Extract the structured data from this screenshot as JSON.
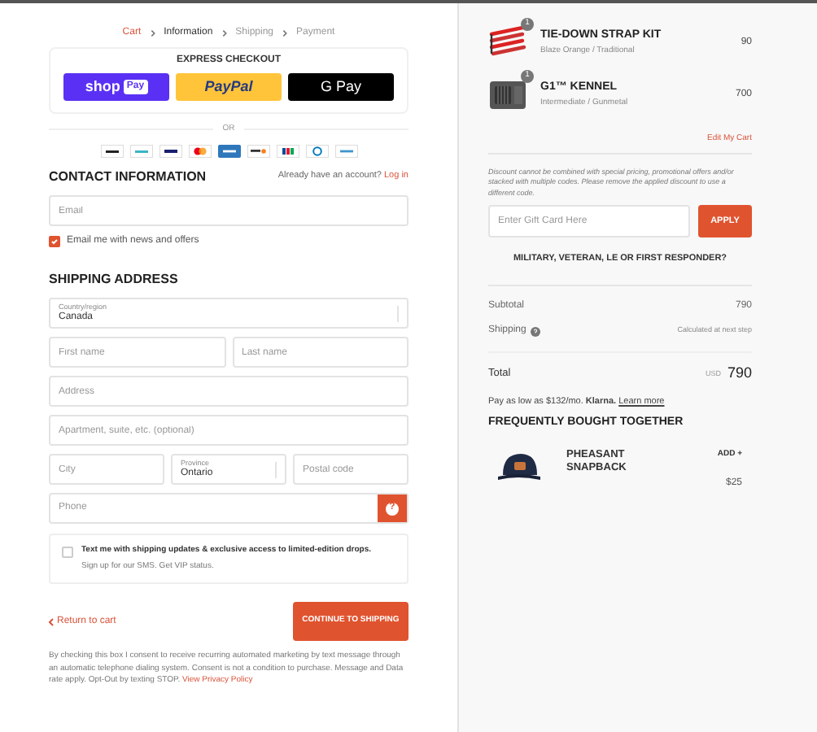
{
  "breadcrumb": [
    {
      "label": "Cart",
      "selected": false,
      "kind": "link"
    },
    {
      "label": "Information",
      "selected": true,
      "kind": "step"
    },
    {
      "label": "Shipping",
      "selected": false,
      "kind": "step"
    },
    {
      "label": "Payment",
      "selected": false,
      "kind": "step"
    }
  ],
  "express_checkout": {
    "title": "EXPRESS CHECKOUT",
    "buttons": [
      {
        "kind": "shop",
        "label": "shop",
        "badge": "Pay"
      },
      {
        "kind": "paypal",
        "label": "PayPal"
      },
      {
        "kind": "gpay",
        "label": "G Pay"
      }
    ]
  },
  "divider_label": "OR",
  "payment_methods": [
    {
      "kind": "klarna"
    },
    {
      "kind": "afterpay"
    },
    {
      "kind": "visa"
    },
    {
      "kind": "mastercard"
    },
    {
      "kind": "amex"
    },
    {
      "kind": "discover"
    },
    {
      "kind": "jcb"
    },
    {
      "kind": "diners"
    },
    {
      "kind": "venmo"
    }
  ],
  "contact": {
    "title": "CONTACT INFORMATION",
    "account_prompt": "Already have an account?",
    "login_link": "Log in",
    "email_placeholder": "Email",
    "newsletter": {
      "label": "Email me with news and offers",
      "checked": true
    }
  },
  "shipping": {
    "title": "SHIPPING ADDRESS",
    "rows": [
      [
        {
          "kind": "select",
          "label": "Country/region",
          "value": "Canada"
        }
      ],
      [
        {
          "kind": "input",
          "placeholder": "First name"
        },
        {
          "kind": "input",
          "placeholder": "Last name"
        }
      ],
      [
        {
          "kind": "input",
          "placeholder": "Address"
        }
      ],
      [
        {
          "kind": "input",
          "placeholder": "Apartment, suite, etc. (optional)"
        }
      ],
      [
        {
          "kind": "input",
          "placeholder": "City"
        },
        {
          "kind": "select",
          "label": "Province",
          "value": "Ontario"
        },
        {
          "kind": "input",
          "placeholder": "Postal code"
        }
      ],
      [
        {
          "kind": "phone",
          "placeholder": "Phone",
          "help": "?"
        }
      ]
    ],
    "sms": {
      "checked": false,
      "title": "Text me with shipping updates & exclusive access to limited-edition drops.",
      "subtitle": "Sign up for our SMS. Get VIP status."
    }
  },
  "return_link": "Return to cart",
  "continue_button": "CONTINUE TO SHIPPING",
  "consent": {
    "text": "By checking this box I consent to receive recurring automated marketing by text message through an automatic telephone dialing system. Consent is not a condition to purchase. Message and Data rate apply. Opt-Out by texting STOP.",
    "link": "View Privacy Policy"
  },
  "cart": {
    "items": [
      {
        "kind": "strap",
        "name": "TIE-DOWN STRAP KIT",
        "variant": "Blaze Orange / Traditional",
        "price": "90",
        "quantity": "1"
      },
      {
        "kind": "kennel",
        "name": "G1™ KENNEL",
        "variant": "Intermediate / Gunmetal",
        "price": "700",
        "quantity": "1"
      }
    ],
    "edit_link": "Edit My Cart",
    "discount_note": "Discount cannot be combined with special pricing, promotional offers and/or stacked with multiple codes. Please remove the applied discount to use a different code.",
    "gift_placeholder": "Enter Gift Card Here",
    "apply_button": "APPLY",
    "military": "MILITARY, VETERAN, LE OR FIRST RESPONDER?",
    "subtotal_label": "Subtotal",
    "subtotal": "790",
    "shipping_label": "Shipping",
    "shipping_value": "Calculated at next step",
    "total_label": "Total",
    "currency": "USD",
    "total": "790",
    "installments": {
      "text": "Pay as low as $132/mo.",
      "brand": "Klarna.",
      "link": "Learn more"
    }
  },
  "frequently_bought": {
    "title": "FREQUENTLY BOUGHT TOGETHER",
    "items": [
      {
        "name": "PHEASANT SNAPBACK",
        "add": "ADD +",
        "price": "$25"
      }
    ]
  }
}
